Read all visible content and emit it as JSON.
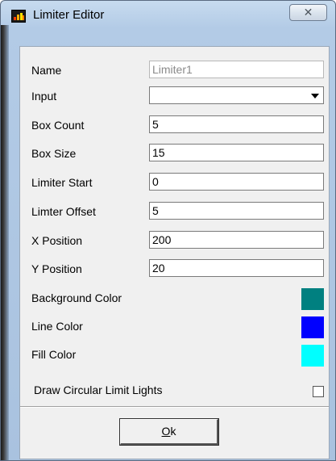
{
  "window": {
    "title": "Limiter Editor",
    "close_glyph": "✕"
  },
  "form": {
    "name": {
      "label": "Name",
      "value": "Limiter1"
    },
    "input": {
      "label": "Input",
      "value": ""
    },
    "box_count": {
      "label": "Box Count",
      "value": "5"
    },
    "box_size": {
      "label": "Box Size",
      "value": "15"
    },
    "limiter_start": {
      "label": "Limiter Start",
      "value": "0"
    },
    "limter_offset": {
      "label": "Limter Offset",
      "value": "5"
    },
    "x_position": {
      "label": "X Position",
      "value": "200"
    },
    "y_position": {
      "label": "Y Position",
      "value": "20"
    },
    "background_color": {
      "label": "Background Color",
      "color": "#008080"
    },
    "line_color": {
      "label": "Line Color",
      "color": "#0000ff"
    },
    "fill_color": {
      "label": "Fill Color",
      "color": "#00ffff"
    },
    "draw_circular": {
      "label": "Draw Circular Limit Lights",
      "checked": false
    }
  },
  "ok_button": {
    "mnemonic": "O",
    "rest": "k"
  },
  "icons": {
    "app": "bar-chart-icon",
    "close": "close-icon",
    "dropdown": "chevron-down-icon"
  }
}
